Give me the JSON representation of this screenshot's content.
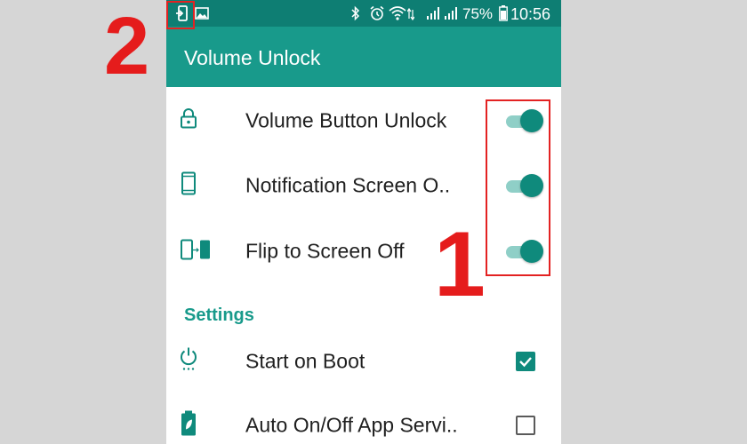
{
  "status_bar": {
    "battery": "75%",
    "time": "10:56"
  },
  "app": {
    "title": "Volume Unlock"
  },
  "toggles": [
    {
      "label": "Volume Button Unlock",
      "icon": "lock-icon",
      "on": true
    },
    {
      "label": "Notification Screen O..",
      "icon": "phone-outline-icon",
      "on": true
    },
    {
      "label": "Flip to Screen Off",
      "icon": "flip-phone-icon",
      "on": true
    }
  ],
  "settings": {
    "header": "Settings",
    "items": [
      {
        "label": "Start on Boot",
        "icon": "power-icon",
        "checked": true
      },
      {
        "label": "Auto On/Off App Servi..",
        "icon": "battery-leaf-icon",
        "checked": false
      }
    ]
  },
  "annotations": {
    "number_1": "1",
    "number_2": "2",
    "color": "#e51c1c"
  },
  "colors": {
    "primary": "#189a8b",
    "primary_dark": "#0e7e73",
    "accent": "#0f8a7c",
    "track": "#8fcfc7"
  }
}
